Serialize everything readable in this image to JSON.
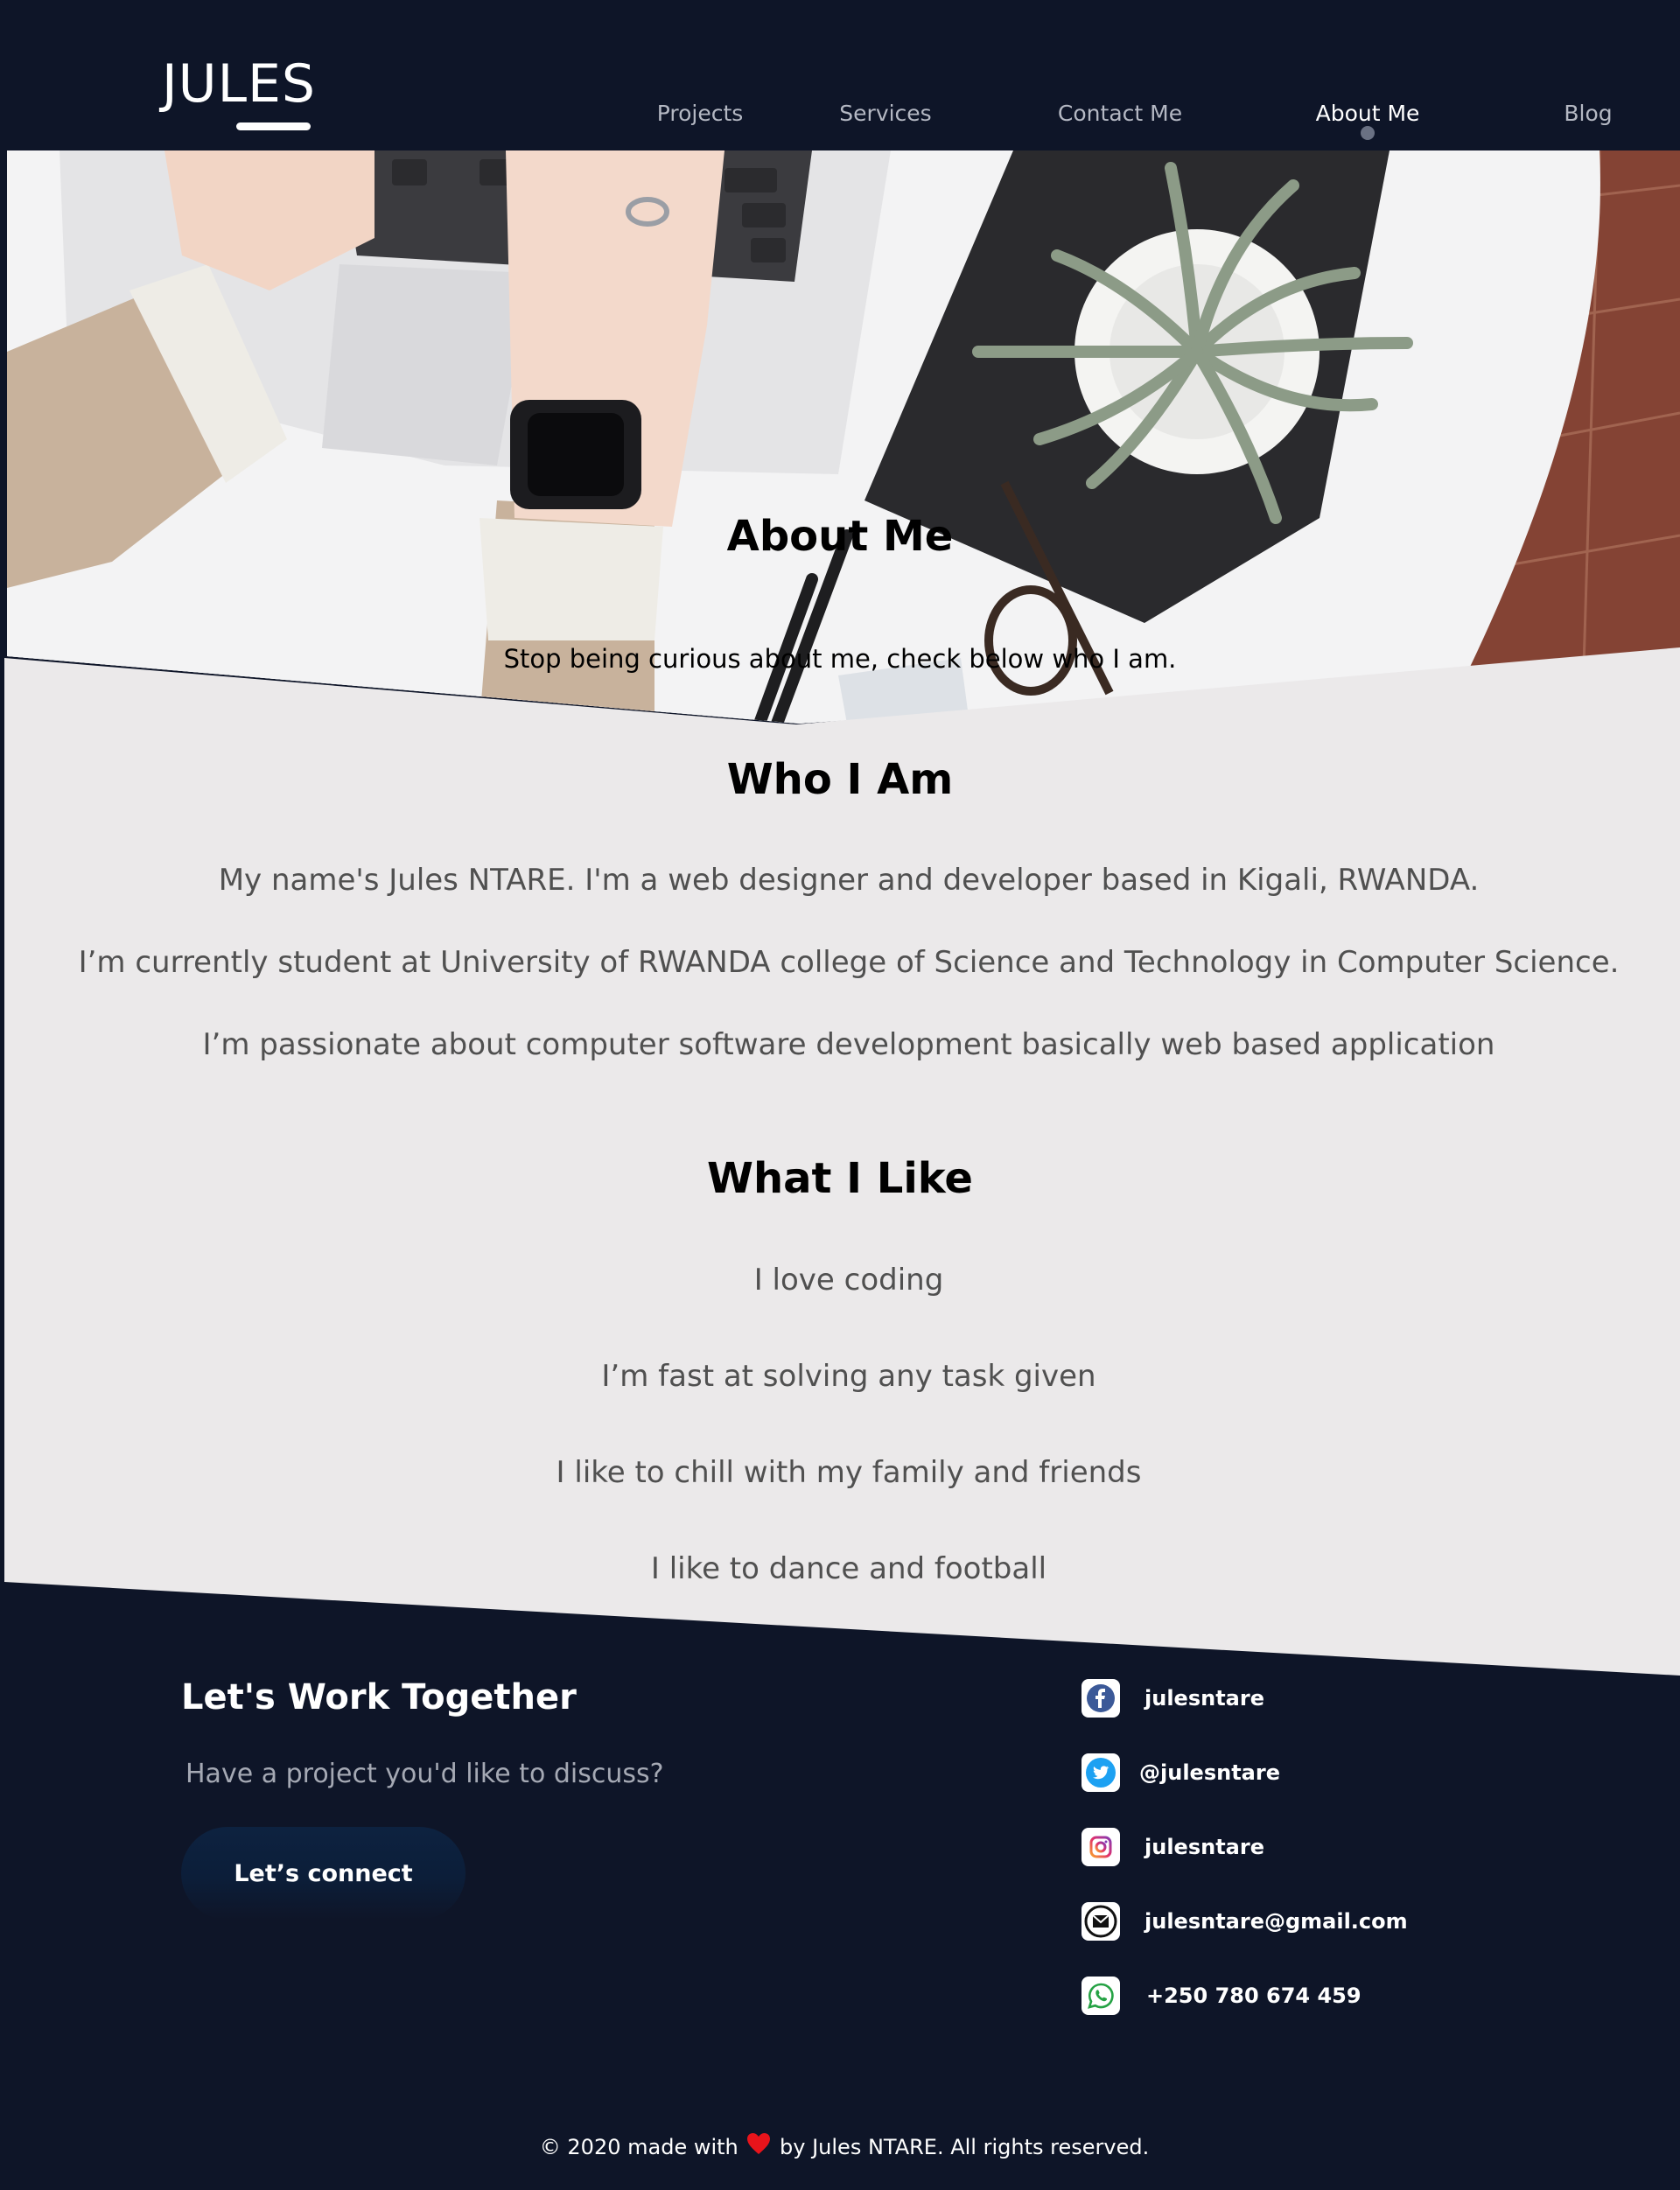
{
  "header": {
    "logo": "JULES",
    "nav": [
      {
        "label": "Projects",
        "active": false
      },
      {
        "label": "Services",
        "active": false
      },
      {
        "label": "Contact Me",
        "active": false
      },
      {
        "label": "About Me",
        "active": true
      },
      {
        "label": "Blog",
        "active": false
      }
    ]
  },
  "hero": {
    "title": "About Me",
    "subtitle": "Stop being curious about me, check below who I am."
  },
  "who": {
    "title": "Who I Am",
    "paragraphs": [
      "My name's Jules NTARE. I'm a web designer and developer based in Kigali, RWANDA.",
      "I’m currently student at University of RWANDA college of Science and Technology in Computer Science.",
      "I’m passionate about computer software development basically web based application"
    ]
  },
  "like": {
    "title": "What I Like",
    "items": [
      "I love coding",
      "I’m fast at solving any task given",
      "I like to chill with my family and friends",
      "I like to dance and football"
    ]
  },
  "footer": {
    "cta_title": "Let's Work Together",
    "cta_subtitle": "Have a project you'd like to discuss?",
    "cta_button": "Let’s connect",
    "socials": [
      {
        "icon": "facebook-icon",
        "label": "julesntare"
      },
      {
        "icon": "twitter-icon",
        "label": "@julesntare"
      },
      {
        "icon": "instagram-icon",
        "label": "julesntare"
      },
      {
        "icon": "email-icon",
        "label": "julesntare@gmail.com"
      },
      {
        "icon": "whatsapp-icon",
        "label": "+250 780 674 459"
      }
    ],
    "copyright_before": "© 2020 made with",
    "copyright_after": "by Jules NTARE. All rights reserved."
  },
  "colors": {
    "dark_background": "#0e1528",
    "light_background": "#ebe9ea",
    "heart": "#e8141b"
  }
}
